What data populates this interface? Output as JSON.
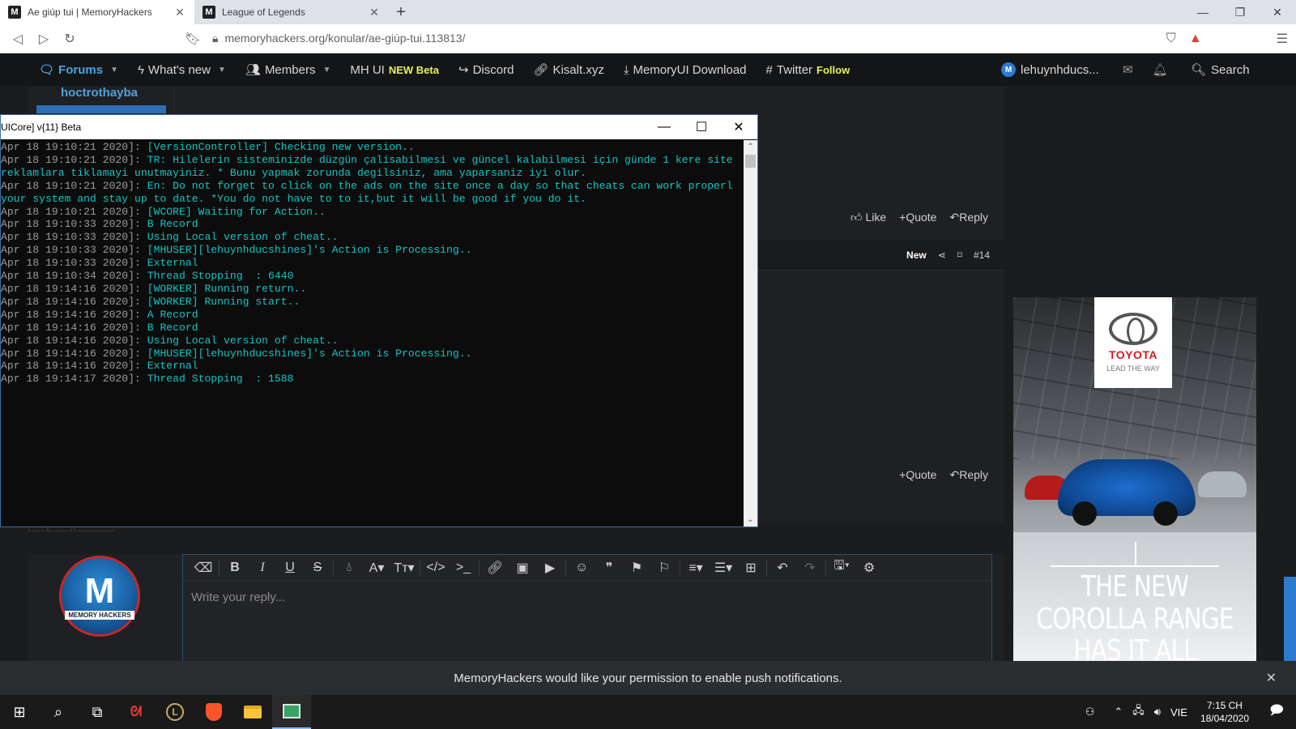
{
  "browser": {
    "tabs": [
      {
        "title": "Ae giúp tui | MemoryHackers",
        "favicon": "M",
        "active": true
      },
      {
        "title": "League of Legends",
        "favicon": "M",
        "active": false
      }
    ],
    "url": "memoryhackers.org/konular/ae-giúp-tui.113813/"
  },
  "site_nav": {
    "forums": "Forums",
    "whats_new": "What's new",
    "members": "Members",
    "mhui": "MH UI",
    "mhui_badge": "NEW Beta",
    "discord": "Discord",
    "kisalt": "Kisalt.xyz",
    "memoryui": "MemoryUI Download",
    "twitter": "Twitter",
    "twitter_follow": "Follow",
    "username": "lehuynhducs...",
    "search": "Search"
  },
  "post1": {
    "author": "hoctrothayba",
    "actions": {
      "like": "Like",
      "quote": "+Quote",
      "reply": "Reply"
    }
  },
  "post2": {
    "new_label": "New",
    "post_number": "#14",
    "actions": {
      "quote": "+Quote",
      "reply": "Reply"
    }
  },
  "reply": {
    "placeholder": "Write your reply...",
    "avatar_letter": "M",
    "avatar_text": "MEMORY HACKERS"
  },
  "ad": {
    "brand": "TOYOTA",
    "tagline": "LEAD THE WAY",
    "headline_1": "THE NEW",
    "headline_2": "COROLLA RANGE",
    "headline_3": "HAS IT ALL"
  },
  "console": {
    "title": "UICore] v{11} Beta",
    "log": [
      {
        "ts": "Apr 18 19:10:21 2020]: ",
        "msg": "[VersionController] Checking new version.."
      },
      {
        "ts": "Apr 18 19:10:21 2020]: ",
        "msg": "TR: Hilelerin sisteminizde düzgün çalisabilmesi ve güncel kalabilmesi için günde 1 kere site"
      },
      {
        "ts": "",
        "msg": "reklamlara tiklamayi unutmayiniz. * Bunu yapmak zorunda degilsiniz, ama yaparsaniz iyi olur."
      },
      {
        "ts": "Apr 18 19:10:21 2020]: ",
        "msg": "En: Do not forget to click on the ads on the site once a day so that cheats can work properl"
      },
      {
        "ts": "",
        "msg": "your system and stay up to date. *You do not have to to it,but it will be good if you do it."
      },
      {
        "ts": "Apr 18 19:10:21 2020]: ",
        "msg": "[WCORE] Waiting for Action.."
      },
      {
        "ts": "Apr 18 19:10:33 2020]: ",
        "msg": "B Record"
      },
      {
        "ts": "Apr 18 19:10:33 2020]: ",
        "msg": "Using Local version of cheat.."
      },
      {
        "ts": "Apr 18 19:10:33 2020]: ",
        "msg": "[MHUSER][lehuynhducshines]'s Action is Processing.."
      },
      {
        "ts": "Apr 18 19:10:33 2020]: ",
        "msg": "External"
      },
      {
        "ts": "Apr 18 19:10:34 2020]: ",
        "msg": "Thread Stopping  : 6440"
      },
      {
        "ts": "Apr 18 19:14:16 2020]: ",
        "msg": "[WORKER] Running return.."
      },
      {
        "ts": "Apr 18 19:14:16 2020]: ",
        "msg": "[WORKER] Running start.."
      },
      {
        "ts": "Apr 18 19:14:16 2020]: ",
        "msg": "A Record"
      },
      {
        "ts": "Apr 18 19:14:16 2020]: ",
        "msg": "B Record"
      },
      {
        "ts": "Apr 18 19:14:16 2020]: ",
        "msg": "Using Local version of cheat.."
      },
      {
        "ts": "Apr 18 19:14:16 2020]: ",
        "msg": "[MHUSER][lehuynhducshines]'s Action is Processing.."
      },
      {
        "ts": "Apr 18 19:14:16 2020]: ",
        "msg": "External"
      },
      {
        "ts": "Apr 18 19:14:17 2020]: ",
        "msg": "Thread Stopping  : 1588"
      }
    ]
  },
  "notification": {
    "text": "MemoryHackers would like your permission to enable push notifications."
  },
  "taskbar": {
    "language": "VIE",
    "time": "7:15 CH",
    "date": "18/04/2020"
  },
  "colors": {
    "accent": "#4aa3df",
    "console_text": "#12c4c4",
    "nav_highlight": "#e8f05a",
    "ad_brand": "#d71920"
  }
}
